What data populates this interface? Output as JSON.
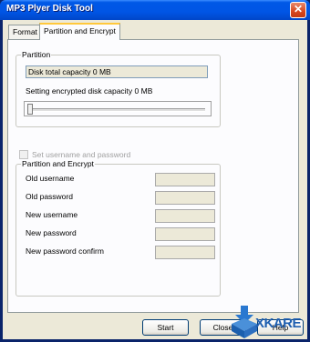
{
  "window": {
    "title": "MP3 Plyer Disk Tool"
  },
  "tabs": [
    {
      "label": "Format",
      "selected": false
    },
    {
      "label": "Partition and Encrypt",
      "selected": true
    }
  ],
  "partition": {
    "legend": "Partition",
    "capacity_text": "Disk total capacity 0 MB",
    "setting_label": "Setting encrypted disk capacity 0 MB",
    "slider_value": 0
  },
  "checkbox": {
    "label": "Set username and password",
    "checked": false,
    "enabled": false
  },
  "encrypt": {
    "legend": "Partition and Encrypt",
    "fields": [
      {
        "label": "Old username",
        "value": ""
      },
      {
        "label": "Old password",
        "value": ""
      },
      {
        "label": "New username",
        "value": ""
      },
      {
        "label": "New password",
        "value": ""
      },
      {
        "label": "New password confirm",
        "value": ""
      }
    ]
  },
  "buttons": {
    "start": "Start",
    "close": "Close",
    "help": "Help"
  },
  "watermark": {
    "text": "XKARE"
  }
}
